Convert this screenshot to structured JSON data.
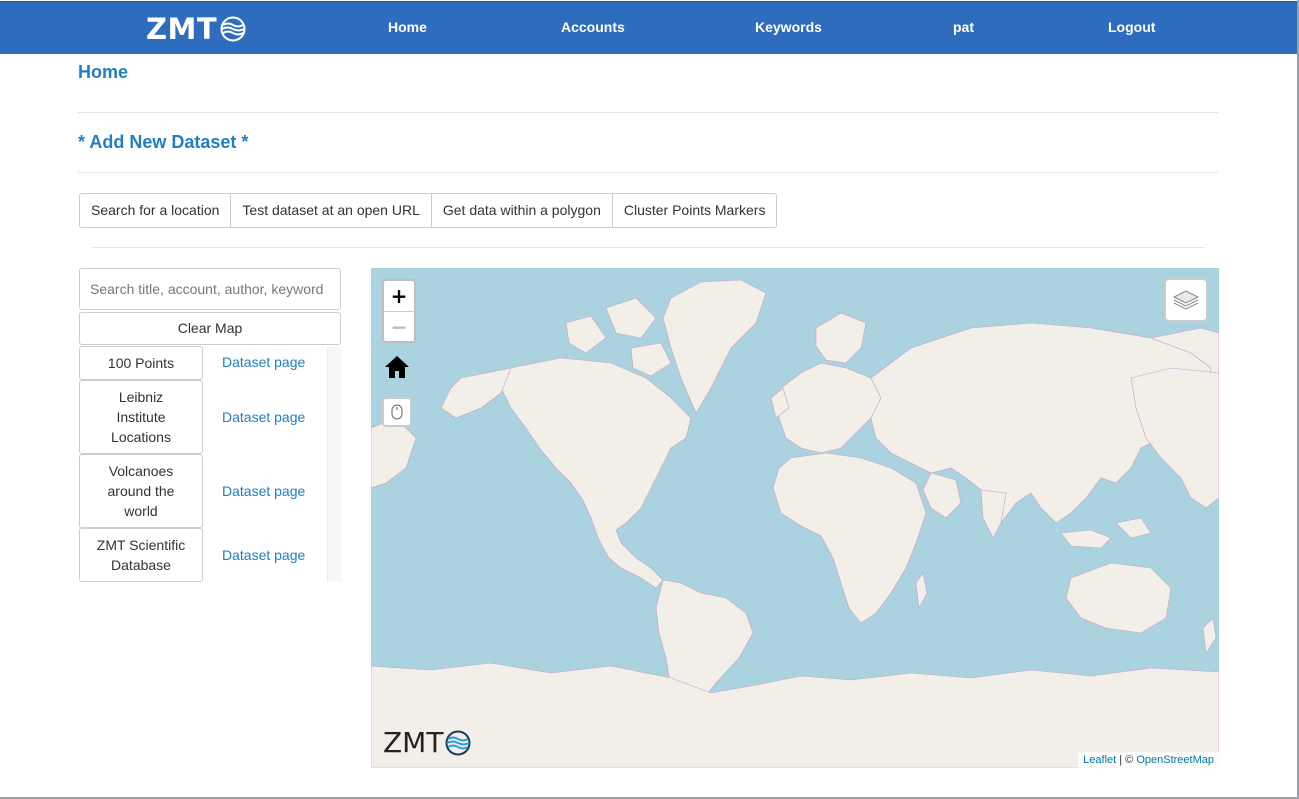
{
  "brand": {
    "logo_text": "ZMT"
  },
  "nav": {
    "items": [
      {
        "label": "Home"
      },
      {
        "label": "Accounts"
      },
      {
        "label": "Keywords"
      },
      {
        "label": "pat"
      },
      {
        "label": "Logout"
      }
    ]
  },
  "page": {
    "breadcrumb": "Home",
    "add_dataset": "* Add New Dataset *"
  },
  "toolbar": {
    "buttons": [
      {
        "label": "Search for a location"
      },
      {
        "label": "Test dataset at an open URL"
      },
      {
        "label": "Get data within a polygon"
      },
      {
        "label": "Cluster Points Markers"
      }
    ]
  },
  "sidebar": {
    "search_placeholder": "Search title, account, author, keyword",
    "clear_label": "Clear Map",
    "datasets": [
      {
        "name": "100 Points",
        "link": "Dataset page"
      },
      {
        "name": "Leibniz Institute Locations",
        "link": "Dataset page"
      },
      {
        "name": "Volcanoes around the world",
        "link": "Dataset page"
      },
      {
        "name": "ZMT Scientific Database",
        "link": "Dataset page"
      }
    ]
  },
  "map": {
    "zoom_in": "+",
    "zoom_out": "−",
    "logo_text": "ZMT",
    "attribution": {
      "leaflet": "Leaflet",
      "separator": " | © ",
      "osm": "OpenStreetMap"
    },
    "colors": {
      "water": "#aad3df",
      "land": "#f2efe9",
      "border": "#c9a0c9"
    }
  }
}
